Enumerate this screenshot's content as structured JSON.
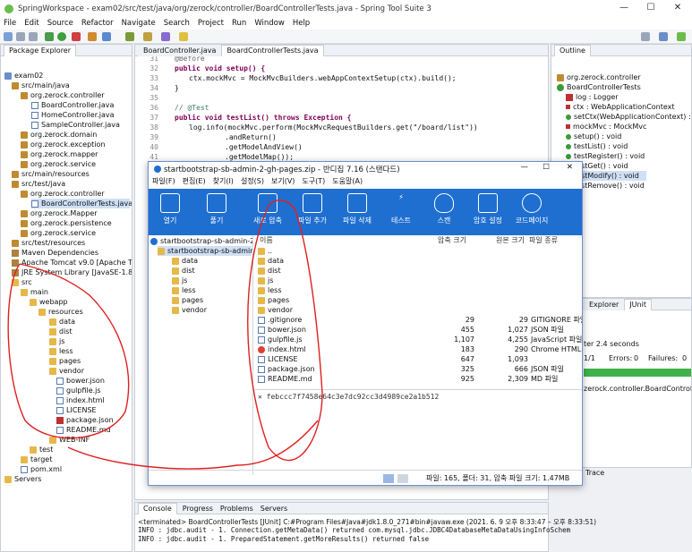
{
  "window": {
    "title": "SpringWorkspace - exam02/src/test/java/org/zerock/controller/BoardControllerTests.java - Spring Tool Suite 3"
  },
  "menu": [
    "File",
    "Edit",
    "Source",
    "Refactor",
    "Navigate",
    "Search",
    "Project",
    "Run",
    "Window",
    "Help"
  ],
  "explorer": {
    "tab": "Package Explorer",
    "items": [
      "exam02",
      "src/main/java",
      "org.zerock.controller",
      "BoardController.java",
      "HomeController.java",
      "SampleController.java",
      "org.zerock.domain",
      "org.zerock.exception",
      "org.zerock.mapper",
      "org.zerock.service",
      "src/main/resources",
      "src/test/java",
      "org.zerock.controller",
      "BoardControllerTests.java",
      "org.zerock.Mapper",
      "org.zerock.persistence",
      "org.zerock.service",
      "src/test/resources",
      "Maven Dependencies",
      "Apache Tomcat v9.0 [Apache Tom",
      "JRE System Library [JavaSE-1.8]",
      "src",
      "main",
      "webapp",
      "resources",
      "data",
      "dist",
      "js",
      "less",
      "pages",
      "vendor",
      "bower.json",
      "gulpfile.js",
      "index.html",
      "LICENSE",
      "package.json",
      "README.md",
      "WEB-INF",
      "test",
      "target",
      "pom.xml",
      "Servers"
    ]
  },
  "editor": {
    "tabs": [
      "BoardController.java",
      "BoardControllerTests.java"
    ],
    "lines": [
      {
        "n": "31",
        "t": "@Before"
      },
      {
        "n": "32",
        "t": "public void setup() {"
      },
      {
        "n": "33",
        "t": "ctx.mockMvc = MockMvcBuilders.webAppContextSetup(ctx).build();"
      },
      {
        "n": "34",
        "t": "}"
      },
      {
        "n": "35",
        "t": ""
      },
      {
        "n": "36",
        "t": "// @Test"
      },
      {
        "n": "37",
        "t": "public void testList() throws Exception {"
      },
      {
        "n": "38",
        "t": "log.info(mockMvc.perform(MockMvcRequestBuilders.get(\"/board/list\"))"
      },
      {
        "n": "39",
        "t": ".andReturn()"
      },
      {
        "n": "40",
        "t": ".getModelAndView()"
      },
      {
        "n": "41",
        "t": ".getModelMap());"
      },
      {
        "n": "42",
        "t": "}"
      },
      {
        "n": "43",
        "t": ""
      }
    ]
  },
  "outline": {
    "tab": "Outline",
    "items": [
      "org.zerock.controller",
      "BoardControllerTests",
      "log : Logger",
      "ctx : WebApplicationContext",
      "setCtx(WebApplicationContext) : void",
      "mockMvc : MockMvc",
      "setup() : void",
      "testList() : void",
      "testRegister() : void",
      "testGet() : void",
      "testModify() : void",
      "testRemove() : void"
    ]
  },
  "junit": {
    "tab": "JUnit",
    "explorer": "Explorer",
    "finished": "ter 2.4 seconds",
    "runs": "1/1",
    "errors_label": "Errors:",
    "errors": "0",
    "failures_label": "Failures:",
    "failures": "0",
    "test_class": "zerock.controller.BoardControllerTe",
    "trace": "Trace"
  },
  "zip": {
    "title": "startbootstrap-sb-admin-2-gh-pages.zip - 반디집 7.16 (스탠다드)",
    "menu": [
      "파일(F)",
      "편집(E)",
      "찾기(I)",
      "설정(S)",
      "보기(V)",
      "도구(T)",
      "도움말(A)"
    ],
    "ribbon": [
      "열기",
      "풀기",
      "새로 압축",
      "파일 추가",
      "파일 삭제",
      "테스트",
      "스캔",
      "암호 설정",
      "코드페이지"
    ],
    "tree": [
      "startbootstrap-sb-admin-2-gh-p",
      "startbootstrap-sb-admin-2-",
      "data",
      "dist",
      "js",
      "less",
      "pages",
      "vendor"
    ],
    "columns": [
      "이름",
      "압축 크기",
      "원본 크기",
      "파일 종류"
    ],
    "files": [
      {
        "name": "..",
        "packed": "",
        "orig": "",
        "type": ""
      },
      {
        "name": "data",
        "packed": "",
        "orig": "",
        "type": ""
      },
      {
        "name": "dist",
        "packed": "",
        "orig": "",
        "type": ""
      },
      {
        "name": "js",
        "packed": "",
        "orig": "",
        "type": ""
      },
      {
        "name": "less",
        "packed": "",
        "orig": "",
        "type": ""
      },
      {
        "name": "pages",
        "packed": "",
        "orig": "",
        "type": ""
      },
      {
        "name": "vendor",
        "packed": "",
        "orig": "",
        "type": ""
      },
      {
        "name": ".gitignore",
        "packed": "29",
        "orig": "29",
        "type": "GITIGNORE 파일"
      },
      {
        "name": "bower.json",
        "packed": "455",
        "orig": "1,027",
        "type": "JSON 파일"
      },
      {
        "name": "gulpfile.js",
        "packed": "1,107",
        "orig": "4,255",
        "type": "JavaScript 파일"
      },
      {
        "name": "index.html",
        "packed": "183",
        "orig": "290",
        "type": "Chrome HTML Do"
      },
      {
        "name": "LICENSE",
        "packed": "647",
        "orig": "1,093",
        "type": ""
      },
      {
        "name": "package.json",
        "packed": "325",
        "orig": "666",
        "type": "JSON 파일"
      },
      {
        "name": "README.md",
        "packed": "925",
        "orig": "2,309",
        "type": "MD 파일"
      }
    ],
    "hash": "febccc7f7458e64c3e7dc92cc3d4989ce2a1b512",
    "status": "파일: 165, 폴더: 31, 압축 파일 크기: 1.47MB"
  },
  "console": {
    "tabs": [
      "Console",
      "Progress",
      "Problems",
      "Servers"
    ],
    "terminated": "<terminated> BoardControllerTests [JUnit] C:#Program Files#Java#jdk1.8.0_271#bin#javaw.exe  (2021. 6. 9 오후 8:33:47 – 오후 8:33:51)",
    "line1": "INFO : jdbc.audit - 1. Connection.getMetaData() returned com.mysql.jdbc.JDBC4DatabaseMetaDataUsingInfoSchem",
    "line2": "INFO : jdbc.audit - 1. PreparedStatement.getMoreResults() returned false"
  }
}
